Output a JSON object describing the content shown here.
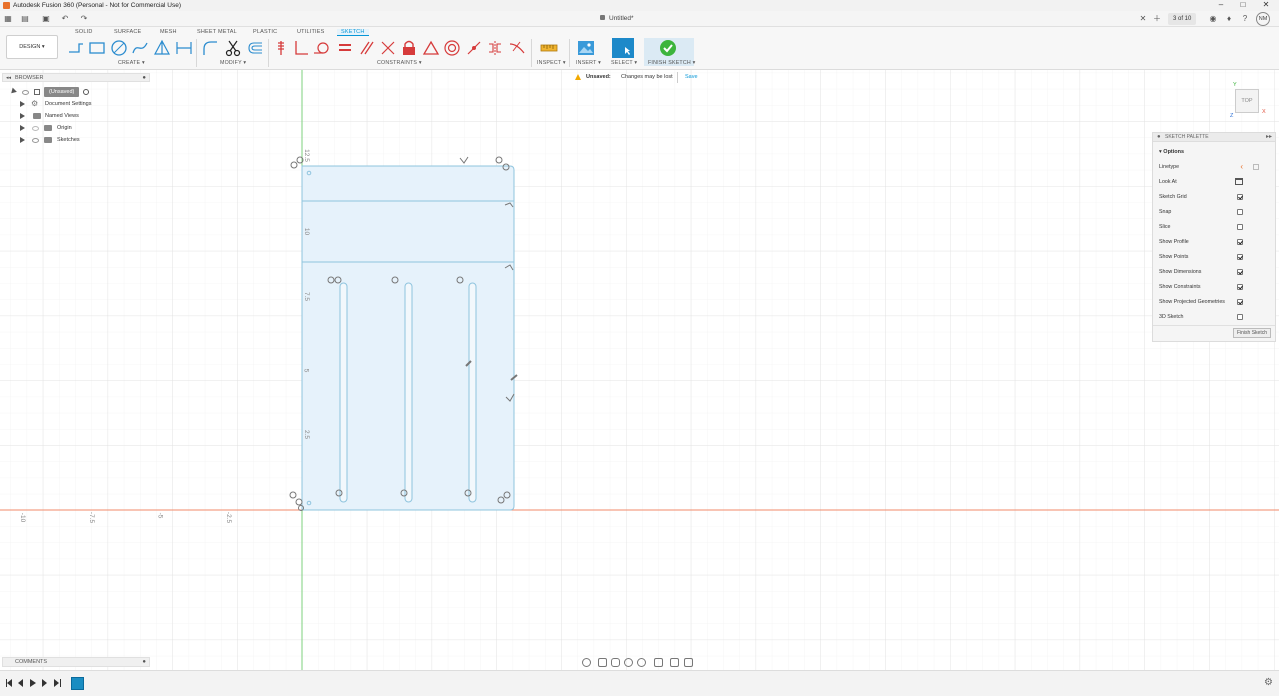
{
  "titlebar": {
    "title": "Autodesk Fusion 360 (Personal - Not for Commercial Use)",
    "minimize": "–",
    "maximize": "□",
    "close": "✕"
  },
  "appbar": {
    "document_title": "Untitled*",
    "page_counter": "3 of 10",
    "user_initials": "NM"
  },
  "toolbar": {
    "workspace": "DESIGN ▾",
    "tabs": [
      "SOLID",
      "SURFACE",
      "MESH",
      "SHEET METAL",
      "PLASTIC",
      "UTILITIES",
      "SKETCH"
    ],
    "active_tab": "SKETCH",
    "groups": {
      "create": "CREATE ▾",
      "modify": "MODIFY ▾",
      "constraints": "CONSTRAINTS ▾",
      "inspect": "INSPECT ▾",
      "insert": "INSERT ▾",
      "select": "SELECT ▾",
      "finish": "FINISH SKETCH ▾"
    }
  },
  "browser": {
    "title": "BROWSER",
    "root": "(Unsaved)",
    "items": [
      "Document Settings",
      "Named Views",
      "Origin",
      "Sketches"
    ]
  },
  "banner": {
    "label": "Unsaved:",
    "message": "Changes may be lost",
    "action": "Save"
  },
  "viewcube": {
    "face": "TOP",
    "axis_x": "X",
    "axis_y": "Y",
    "axis_z": "Z"
  },
  "sketch_palette": {
    "title": "SKETCH PALETTE",
    "section": "Options",
    "rows": [
      {
        "label": "Linetype",
        "kind": "icons"
      },
      {
        "label": "Look At",
        "kind": "icon"
      },
      {
        "label": "Sketch Grid",
        "checked": true
      },
      {
        "label": "Snap",
        "checked": false
      },
      {
        "label": "Slice",
        "checked": false
      },
      {
        "label": "Show Profile",
        "checked": true
      },
      {
        "label": "Show Points",
        "checked": true
      },
      {
        "label": "Show Dimensions",
        "checked": true
      },
      {
        "label": "Show Constraints",
        "checked": true
      },
      {
        "label": "Show Projected Geometries",
        "checked": true
      },
      {
        "label": "3D Sketch",
        "checked": false
      }
    ],
    "finish_button": "Finish Sketch"
  },
  "canvas": {
    "x_axis_ticks": [
      "-10",
      "-7.5",
      "-5",
      "-2.5"
    ],
    "y_axis_ticks": [
      "12.5",
      "10",
      "7.5",
      "5",
      "2.5"
    ],
    "x_axis_color": "#f08a6a",
    "y_axis_color": "#7ed07e",
    "profile_fill": "#e6f2fb",
    "sketch_line_color": "#8fc4de"
  },
  "comments": {
    "title": "COMMENTS"
  },
  "colors": {
    "accent": "#0696d7",
    "finish_green": "#3cb43c"
  }
}
